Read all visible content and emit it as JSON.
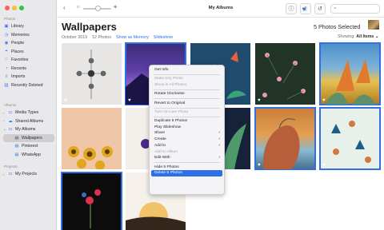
{
  "window": {
    "title": "My Albums"
  },
  "sidebar": {
    "sections": [
      {
        "label": "Photos",
        "items": [
          {
            "label": "Library",
            "icon": "photo-library-icon",
            "glyph": "▣"
          },
          {
            "label": "Memories",
            "icon": "memories-icon",
            "glyph": "◷"
          },
          {
            "label": "People",
            "icon": "people-icon",
            "glyph": "◉"
          },
          {
            "label": "Places",
            "icon": "places-icon",
            "glyph": "⌖"
          },
          {
            "label": "Favorites",
            "icon": "heart-icon",
            "glyph": "♡"
          },
          {
            "label": "Recents",
            "icon": "clock-icon",
            "glyph": "◔"
          },
          {
            "label": "Imports",
            "icon": "import-icon",
            "glyph": "⇩"
          },
          {
            "label": "Recently Deleted",
            "icon": "trash-icon",
            "glyph": "▥"
          }
        ]
      },
      {
        "label": "Albums",
        "items": [
          {
            "label": "Media Types",
            "icon": "folder-icon",
            "glyph": "▭",
            "chevron": "›"
          },
          {
            "label": "Shared Albums",
            "icon": "cloud-icon",
            "glyph": "☁",
            "chevron": "›"
          },
          {
            "label": "My Albums",
            "icon": "folder-icon",
            "glyph": "▭",
            "chevron": "⌄"
          },
          {
            "label": "Wallpapers",
            "icon": "album-icon",
            "glyph": "▤",
            "selected": true
          },
          {
            "label": "Pinterest",
            "icon": "album-icon",
            "glyph": "▤"
          },
          {
            "label": "WhatsApp",
            "icon": "album-icon",
            "glyph": "▤"
          }
        ]
      },
      {
        "label": "Projects",
        "items": [
          {
            "label": "My Projects",
            "icon": "folder-icon",
            "glyph": "▭",
            "chevron": "›"
          }
        ]
      }
    ]
  },
  "toolbar": {
    "back_glyph": "‹",
    "zoom_small_glyph": "☼",
    "zoom_large_glyph": "☀",
    "zoom_level": 0.55,
    "info_glyph": "ⓘ",
    "share_glyph": "⇪",
    "heart_glyph": "♥",
    "rotate_glyph": "↺",
    "search_glyph": "⌕",
    "search_value": "",
    "search_placeholder": ""
  },
  "header": {
    "title": "Wallpapers",
    "date": "October 2019",
    "count": "12 Photos",
    "show_memory": "Show as Memory",
    "slideshow": "Slideshow",
    "selected": "5 Photos Selected",
    "showing_label": "Showing:",
    "showing_value": "All Items ⌄"
  },
  "photos": [
    {
      "selected": false,
      "favorite": true
    },
    {
      "selected": true,
      "favorite": true
    },
    {
      "selected": false,
      "favorite": true
    },
    {
      "selected": false,
      "favorite": true
    },
    {
      "selected": false,
      "favorite": false
    },
    {
      "selected": true,
      "favorite": true
    },
    {
      "selected": false,
      "favorite": false
    },
    {
      "selected": false,
      "favorite": false
    },
    {
      "selected": false,
      "favorite": false
    },
    {
      "selected": false,
      "favorite": false
    },
    {
      "selected": true,
      "favorite": true
    },
    {
      "selected": true,
      "favorite": true
    },
    {
      "selected": true,
      "favorite": false
    },
    {
      "selected": false,
      "favorite": false
    }
  ],
  "heart_glyph": "♥",
  "context_menu": [
    {
      "label": "Get Info"
    },
    {
      "sep": true
    },
    {
      "label": "Make Key Photo",
      "disabled": true
    },
    {
      "label": "Show in All Photos",
      "disabled": true
    },
    {
      "sep": true
    },
    {
      "label": "Rotate Clockwise"
    },
    {
      "sep": true
    },
    {
      "label": "Revert to Original"
    },
    {
      "sep": true
    },
    {
      "label": "Turn On Live Photo",
      "disabled": true
    },
    {
      "sep": true
    },
    {
      "label": "Duplicate 5 Photos"
    },
    {
      "label": "Play Slideshow"
    },
    {
      "label": "Share",
      "submenu": true
    },
    {
      "label": "Create",
      "submenu": true
    },
    {
      "label": "Add to",
      "submenu": true
    },
    {
      "label": "Add to Album",
      "disabled": true
    },
    {
      "label": "Edit With",
      "submenu": true
    },
    {
      "sep": true
    },
    {
      "label": "Hide 5 Photos"
    },
    {
      "label": "Delete 5 Photos",
      "active": true
    }
  ],
  "submenu_glyph": "›"
}
